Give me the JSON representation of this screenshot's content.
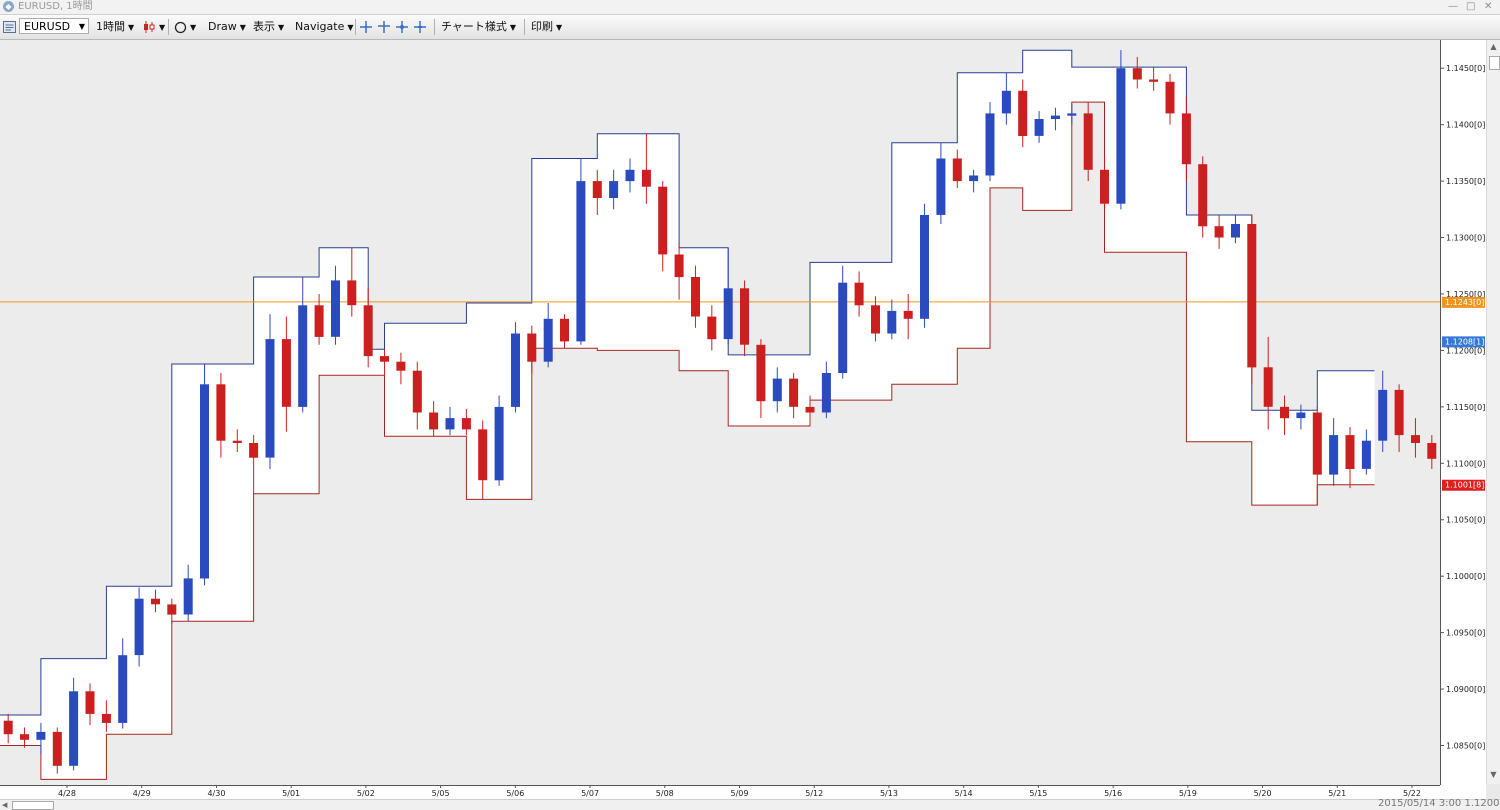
{
  "window": {
    "title": "EURUSD, 1時間",
    "controls": [
      "—",
      "□",
      "✕"
    ]
  },
  "toolbar": {
    "symbol": "EURUSD",
    "timeframe": "1時間",
    "draw": "Draw",
    "view": "表示",
    "navigate": "Navigate",
    "chart_style": "チャート様式",
    "print": "印刷"
  },
  "status": {
    "text": "2015/05/14 3:00   1.12002"
  },
  "price_tags": [
    {
      "label": "1.1243[0]",
      "price": 1.1243,
      "color": "#f0941e"
    },
    {
      "label": "1.1208[1]",
      "price": 1.1208,
      "color": "#3478d8"
    },
    {
      "label": "1.1001[8]",
      "price": 1.1081,
      "color": "#e01e1e"
    }
  ],
  "chart_data": {
    "type": "candlestick",
    "symbol": "EURUSD",
    "timeframe": "1時間",
    "ylim": [
      1.0815,
      1.1475
    ],
    "y_ticks": [
      {
        "value": 1.085,
        "label": "1.0850[0]"
      },
      {
        "value": 1.09,
        "label": "1.0900[0]"
      },
      {
        "value": 1.095,
        "label": "1.0950[0]"
      },
      {
        "value": 1.1,
        "label": "1.1000[0]"
      },
      {
        "value": 1.105,
        "label": "1.1050[0]"
      },
      {
        "value": 1.11,
        "label": "1.1100[0]"
      },
      {
        "value": 1.115,
        "label": "1.1150[0]"
      },
      {
        "value": 1.12,
        "label": "1.1200[0]"
      },
      {
        "value": 1.125,
        "label": "1.1250[0]"
      },
      {
        "value": 1.13,
        "label": "1.1300[0]"
      },
      {
        "value": 1.135,
        "label": "1.1350[0]"
      },
      {
        "value": 1.14,
        "label": "1.1400[0]"
      },
      {
        "value": 1.145,
        "label": "1.1450[0]"
      }
    ],
    "x_labels": [
      "4/28",
      "4/29",
      "4/30",
      "5/01",
      "5/02",
      "5/05",
      "5/06",
      "5/07",
      "5/08",
      "5/09",
      "5/12",
      "5/13",
      "5/14",
      "5/15",
      "5/16",
      "5/19",
      "5/20",
      "5/21",
      "5/22"
    ],
    "horizontal_line": {
      "price": 1.1243,
      "color": "#f0941e"
    },
    "envelope": {
      "upper": [
        [
          0,
          1.0877
        ],
        [
          2.5,
          1.0877
        ],
        [
          2.5,
          1.0927
        ],
        [
          6.5,
          1.0927
        ],
        [
          6.5,
          1.0991
        ],
        [
          10.5,
          1.0991
        ],
        [
          10.5,
          1.1188
        ],
        [
          15.5,
          1.1188
        ],
        [
          15.5,
          1.1265
        ],
        [
          19.5,
          1.1265
        ],
        [
          19.5,
          1.1291
        ],
        [
          22.5,
          1.1291
        ],
        [
          22.5,
          1.1201
        ],
        [
          23.5,
          1.1201
        ],
        [
          23.5,
          1.1224
        ],
        [
          28.5,
          1.1224
        ],
        [
          28.5,
          1.1242
        ],
        [
          32.5,
          1.1242
        ],
        [
          32.5,
          1.137
        ],
        [
          36.5,
          1.137
        ],
        [
          36.5,
          1.1392
        ],
        [
          41.5,
          1.1392
        ],
        [
          41.5,
          1.1291
        ],
        [
          44.5,
          1.1291
        ],
        [
          44.5,
          1.1196
        ],
        [
          49.5,
          1.1196
        ],
        [
          49.5,
          1.1278
        ],
        [
          54.5,
          1.1278
        ],
        [
          54.5,
          1.1384
        ],
        [
          58.5,
          1.1384
        ],
        [
          58.5,
          1.1446
        ],
        [
          62.5,
          1.1446
        ],
        [
          62.5,
          1.1466
        ],
        [
          65.5,
          1.1466
        ],
        [
          65.5,
          1.1451
        ],
        [
          72.5,
          1.1451
        ],
        [
          72.5,
          1.132
        ],
        [
          76.5,
          1.132
        ],
        [
          76.5,
          1.1147
        ],
        [
          80.5,
          1.1147
        ],
        [
          80.5,
          1.1182
        ],
        [
          84,
          1.1182
        ]
      ],
      "lower": [
        [
          0,
          1.085
        ],
        [
          2.5,
          1.085
        ],
        [
          2.5,
          1.082
        ],
        [
          6.5,
          1.082
        ],
        [
          6.5,
          1.086
        ],
        [
          10.5,
          1.086
        ],
        [
          10.5,
          1.096
        ],
        [
          15.5,
          1.096
        ],
        [
          15.5,
          1.1073
        ],
        [
          19.5,
          1.1073
        ],
        [
          19.5,
          1.1178
        ],
        [
          23.5,
          1.1178
        ],
        [
          23.5,
          1.1124
        ],
        [
          28.5,
          1.1124
        ],
        [
          28.5,
          1.1068
        ],
        [
          32.5,
          1.1068
        ],
        [
          32.5,
          1.1202
        ],
        [
          36.5,
          1.1202
        ],
        [
          36.5,
          1.12
        ],
        [
          41.5,
          1.12
        ],
        [
          41.5,
          1.1182
        ],
        [
          44.5,
          1.1182
        ],
        [
          44.5,
          1.1133
        ],
        [
          49.5,
          1.1133
        ],
        [
          49.5,
          1.1156
        ],
        [
          54.5,
          1.1156
        ],
        [
          54.5,
          1.117
        ],
        [
          58.5,
          1.117
        ],
        [
          58.5,
          1.1202
        ],
        [
          60.5,
          1.1202
        ],
        [
          60.5,
          1.1344
        ],
        [
          62.5,
          1.1344
        ],
        [
          62.5,
          1.1324
        ],
        [
          65.5,
          1.1324
        ],
        [
          65.5,
          1.142
        ],
        [
          67.5,
          1.142
        ],
        [
          67.5,
          1.1287
        ],
        [
          72.5,
          1.1287
        ],
        [
          72.5,
          1.1119
        ],
        [
          76.5,
          1.1119
        ],
        [
          76.5,
          1.1063
        ],
        [
          80.5,
          1.1063
        ],
        [
          80.5,
          1.1081
        ],
        [
          84,
          1.1081
        ]
      ]
    },
    "candles": [
      [
        1.0872,
        1.0878,
        1.0852,
        1.086
      ],
      [
        1.086,
        1.0866,
        1.0848,
        1.0855
      ],
      [
        1.0855,
        1.087,
        1.0842,
        1.0862
      ],
      [
        1.0862,
        1.0866,
        1.0825,
        1.0832
      ],
      [
        1.0832,
        1.091,
        1.0828,
        1.0898
      ],
      [
        1.0898,
        1.0905,
        1.0868,
        1.0878
      ],
      [
        1.0878,
        1.089,
        1.0862,
        1.087
      ],
      [
        1.087,
        1.0945,
        1.0865,
        1.093
      ],
      [
        1.093,
        1.099,
        1.092,
        1.098
      ],
      [
        1.098,
        1.0988,
        1.0968,
        1.0975
      ],
      [
        1.0975,
        1.098,
        1.0958,
        1.0966
      ],
      [
        1.0966,
        1.101,
        1.096,
        1.0998
      ],
      [
        1.0998,
        1.1188,
        1.0992,
        1.117
      ],
      [
        1.117,
        1.118,
        1.1105,
        1.112
      ],
      [
        1.112,
        1.113,
        1.111,
        1.1118
      ],
      [
        1.1118,
        1.1125,
        1.1073,
        1.1105
      ],
      [
        1.1105,
        1.1232,
        1.1095,
        1.121
      ],
      [
        1.121,
        1.123,
        1.1128,
        1.115
      ],
      [
        1.115,
        1.1265,
        1.1145,
        1.124
      ],
      [
        1.124,
        1.125,
        1.1205,
        1.1212
      ],
      [
        1.1212,
        1.1275,
        1.1205,
        1.1262
      ],
      [
        1.1262,
        1.1291,
        1.123,
        1.124
      ],
      [
        1.124,
        1.1255,
        1.1185,
        1.1195
      ],
      [
        1.1195,
        1.1201,
        1.1178,
        1.119
      ],
      [
        1.119,
        1.1198,
        1.117,
        1.1182
      ],
      [
        1.1182,
        1.119,
        1.113,
        1.1145
      ],
      [
        1.1145,
        1.1155,
        1.1124,
        1.113
      ],
      [
        1.113,
        1.115,
        1.1125,
        1.114
      ],
      [
        1.114,
        1.1148,
        1.1125,
        1.113
      ],
      [
        1.113,
        1.1138,
        1.1068,
        1.1085
      ],
      [
        1.1085,
        1.116,
        1.108,
        1.115
      ],
      [
        1.115,
        1.1225,
        1.1145,
        1.1215
      ],
      [
        1.1215,
        1.1222,
        1.118,
        1.119
      ],
      [
        1.119,
        1.1242,
        1.1185,
        1.1228
      ],
      [
        1.1228,
        1.1232,
        1.1202,
        1.1208
      ],
      [
        1.1208,
        1.137,
        1.1205,
        1.135
      ],
      [
        1.135,
        1.136,
        1.132,
        1.1335
      ],
      [
        1.1335,
        1.136,
        1.1325,
        1.135
      ],
      [
        1.135,
        1.137,
        1.134,
        1.136
      ],
      [
        1.136,
        1.1392,
        1.133,
        1.1345
      ],
      [
        1.1345,
        1.135,
        1.127,
        1.1285
      ],
      [
        1.1285,
        1.1295,
        1.1245,
        1.1265
      ],
      [
        1.1265,
        1.1275,
        1.122,
        1.123
      ],
      [
        1.123,
        1.124,
        1.12,
        1.121
      ],
      [
        1.121,
        1.1291,
        1.1205,
        1.1255
      ],
      [
        1.1255,
        1.1262,
        1.1195,
        1.1205
      ],
      [
        1.1205,
        1.121,
        1.114,
        1.1155
      ],
      [
        1.1155,
        1.1185,
        1.1145,
        1.1175
      ],
      [
        1.1175,
        1.118,
        1.114,
        1.115
      ],
      [
        1.115,
        1.116,
        1.1133,
        1.1145
      ],
      [
        1.1145,
        1.119,
        1.114,
        1.118
      ],
      [
        1.118,
        1.1275,
        1.1175,
        1.126
      ],
      [
        1.126,
        1.127,
        1.123,
        1.124
      ],
      [
        1.124,
        1.1248,
        1.1208,
        1.1215
      ],
      [
        1.1215,
        1.1245,
        1.121,
        1.1235
      ],
      [
        1.1235,
        1.125,
        1.121,
        1.1228
      ],
      [
        1.1228,
        1.133,
        1.122,
        1.132
      ],
      [
        1.132,
        1.1384,
        1.1312,
        1.137
      ],
      [
        1.137,
        1.1378,
        1.1344,
        1.135
      ],
      [
        1.135,
        1.136,
        1.134,
        1.1355
      ],
      [
        1.1355,
        1.142,
        1.135,
        1.141
      ],
      [
        1.141,
        1.1446,
        1.14,
        1.143
      ],
      [
        1.143,
        1.144,
        1.138,
        1.139
      ],
      [
        1.139,
        1.1412,
        1.1384,
        1.1405
      ],
      [
        1.1405,
        1.1415,
        1.1395,
        1.1408
      ],
      [
        1.1408,
        1.1418,
        1.14,
        1.141
      ],
      [
        1.141,
        1.142,
        1.135,
        1.136
      ],
      [
        1.136,
        1.1372,
        1.1324,
        1.133
      ],
      [
        1.133,
        1.1466,
        1.1325,
        1.145
      ],
      [
        1.145,
        1.146,
        1.1432,
        1.144
      ],
      [
        1.144,
        1.1451,
        1.143,
        1.1438
      ],
      [
        1.1438,
        1.1445,
        1.14,
        1.141
      ],
      [
        1.141,
        1.1425,
        1.135,
        1.1365
      ],
      [
        1.1365,
        1.1372,
        1.13,
        1.131
      ],
      [
        1.131,
        1.132,
        1.129,
        1.13
      ],
      [
        1.13,
        1.132,
        1.1295,
        1.1312
      ],
      [
        1.1312,
        1.132,
        1.117,
        1.1185
      ],
      [
        1.1185,
        1.1212,
        1.113,
        1.115
      ],
      [
        1.115,
        1.116,
        1.1125,
        1.114
      ],
      [
        1.114,
        1.1152,
        1.113,
        1.1145
      ],
      [
        1.1145,
        1.115,
        1.1063,
        1.109
      ],
      [
        1.109,
        1.114,
        1.108,
        1.1125
      ],
      [
        1.1125,
        1.1132,
        1.1078,
        1.1095
      ],
      [
        1.1095,
        1.113,
        1.109,
        1.112
      ],
      [
        1.112,
        1.1182,
        1.111,
        1.1165
      ],
      [
        1.1165,
        1.117,
        1.111,
        1.1125
      ],
      [
        1.1125,
        1.114,
        1.1105,
        1.1118
      ],
      [
        1.1118,
        1.1125,
        1.1095,
        1.1104
      ]
    ],
    "up_color": "#2a4bc0",
    "down_color": "#cc1f1f",
    "envelope_upper_color": "#27408e",
    "envelope_lower_color": "#a8231f",
    "grid": false
  }
}
